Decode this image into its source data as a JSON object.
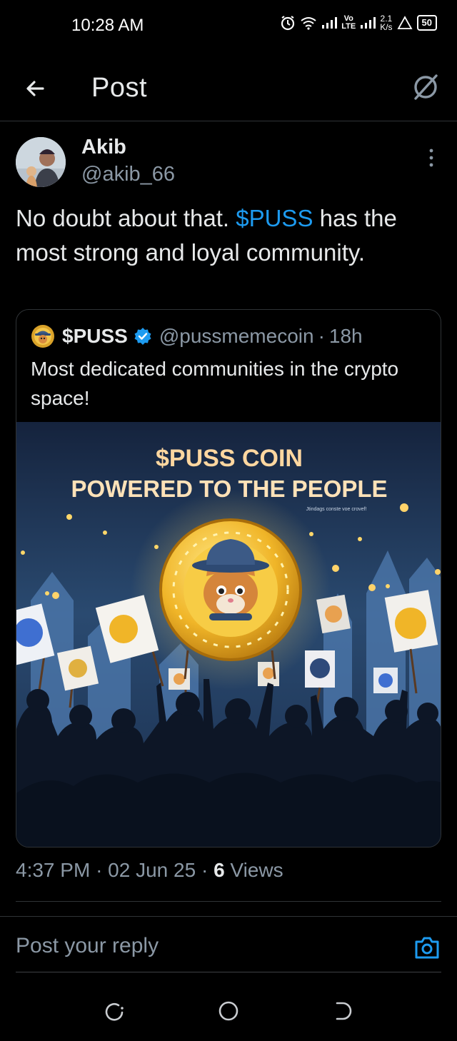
{
  "status_bar": {
    "time": "10:28 AM",
    "volte": "Vo",
    "lte": "LTE",
    "speed_value": "2.1",
    "speed_unit": "K/s",
    "battery": "50"
  },
  "header": {
    "title": "Post"
  },
  "post": {
    "author_name": "Akib",
    "author_handle": "@akib_66",
    "text_before": "No doubt about that. ",
    "cashtag": "$PUSS",
    "text_after": " has the most strong and loyal community."
  },
  "quote": {
    "name": "$PUSS",
    "handle": "@pussmemecoin",
    "separator": "·",
    "time": "18h",
    "text": "Most dedicated communities in the crypto space!",
    "image": {
      "title_line1": "$PUSS COIN",
      "title_line2": "POWERED TO THE PEOPLE",
      "small_text": "Jtindags conste voe crovef!",
      "coin_symbol": "$"
    }
  },
  "meta": {
    "time": "4:37 PM",
    "separator": "·",
    "date": "02 Jun 25",
    "views_count": "6",
    "views_label": " Views"
  },
  "reply": {
    "placeholder": "Post your reply"
  },
  "colors": {
    "accent": "#1d9bf0",
    "background": "#000000",
    "text": "#e7e9ea",
    "muted": "#8b98a5",
    "border": "#2f3336"
  }
}
